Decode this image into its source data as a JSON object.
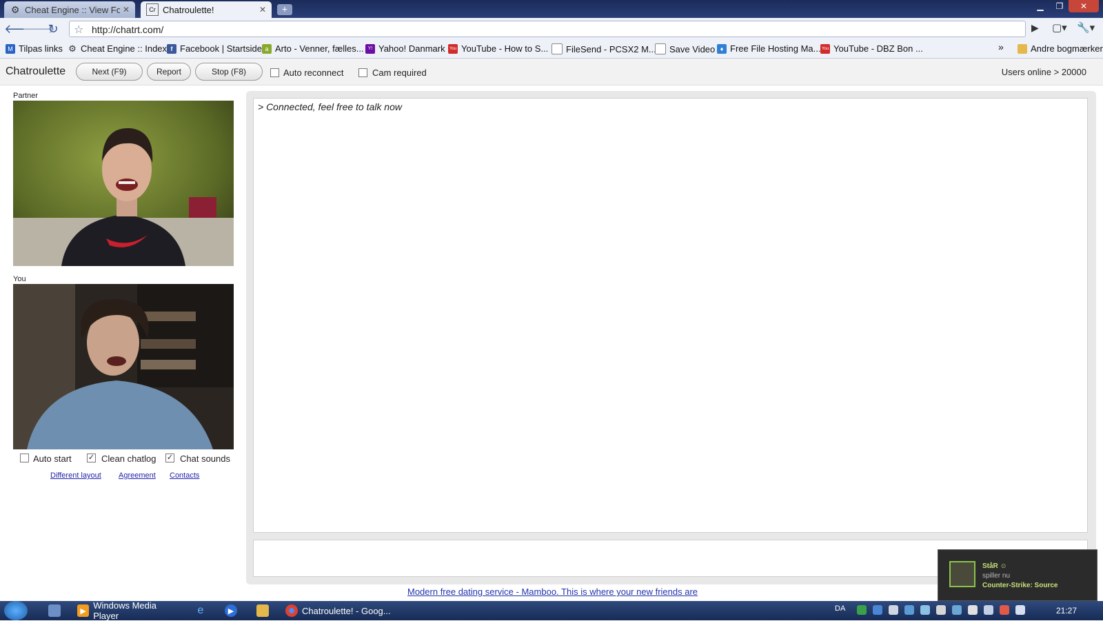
{
  "browser": {
    "tabs": [
      {
        "title": "Cheat Engine :: View Foru..."
      },
      {
        "title": "Chatroulette!",
        "favicon": "Cr"
      }
    ],
    "new_tab": "+",
    "window_controls": {
      "minimize": "▁",
      "maximize": "❐",
      "close": "✕"
    },
    "url": "http://chatrt.com/",
    "bookmarks": [
      {
        "label": "Tilpas links",
        "icon": "M"
      },
      {
        "label": "Cheat Engine :: Index",
        "icon": "gear"
      },
      {
        "label": "Facebook | Startside",
        "icon": "f"
      },
      {
        "label": "Arto - Venner, fælles...",
        "icon": "a"
      },
      {
        "label": "Yahoo! Danmark",
        "icon": "Y!"
      },
      {
        "label": "YouTube - How to S...",
        "icon": "You"
      },
      {
        "label": "FileSend - PCSX2 M...",
        "icon": "doc"
      },
      {
        "label": "Save Video",
        "icon": "doc"
      },
      {
        "label": "Free File Hosting Ma...",
        "icon": "drop"
      },
      {
        "label": "YouTube - DBZ Bon ...",
        "icon": "You"
      }
    ],
    "bookmarks_more": "»",
    "other_bookmarks": "Andre bogmærker"
  },
  "chat": {
    "brand": "Chatroulette",
    "buttons": {
      "next": "Next (F9)",
      "report": "Report",
      "stop": "Stop (F8)"
    },
    "options": {
      "auto_reconnect": "Auto reconnect",
      "cam_required": "Cam required"
    },
    "users_online": "Users online > 20000",
    "partner_label": "Partner",
    "you_label": "You",
    "bottom_options": {
      "auto_start": {
        "label": "Auto start",
        "checked": false
      },
      "clean_chatlog": {
        "label": "Clean chatlog",
        "checked": true
      },
      "chat_sounds": {
        "label": "Chat sounds",
        "checked": true
      }
    },
    "links": {
      "different_layout": "Different layout",
      "agreement": "Agreement",
      "contacts": "Contacts"
    },
    "log_line": "> Connected, feel free to talk now",
    "ad_text": "Modern free dating service - Mamboo. This is where your new friends are"
  },
  "toast": {
    "name": "StåR ☺",
    "status": "spiller nu",
    "game": "Counter-Strike: Source"
  },
  "taskbar": {
    "items": [
      {
        "label": "Windows Media Player"
      },
      {
        "label": "Chatroulette! - Goog..."
      }
    ],
    "language": "DA",
    "clock": "21:27"
  },
  "colors": {
    "accent": "#3a5a99",
    "link": "#2222aa",
    "steam_green": "#8bc34a"
  }
}
